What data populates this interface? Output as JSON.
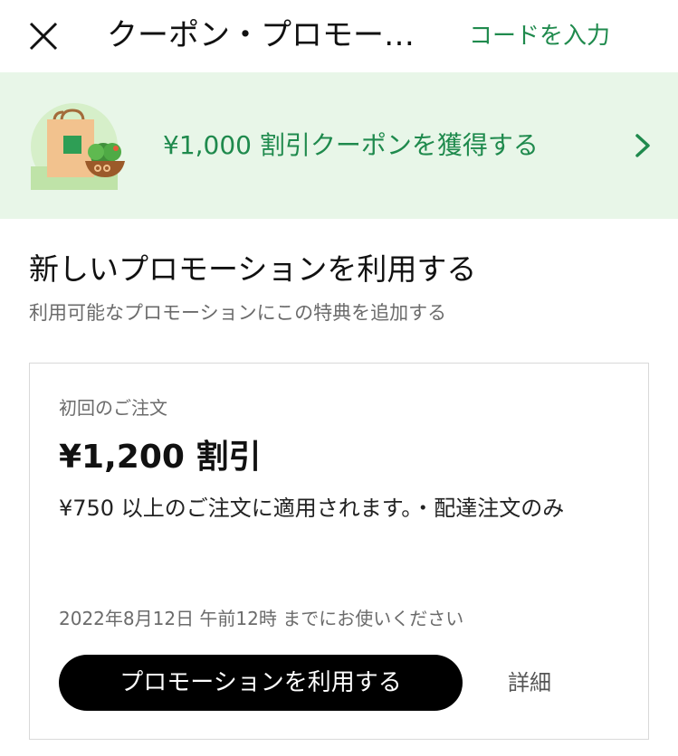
{
  "header": {
    "close_icon": "close-icon",
    "title": "クーポン・プロモー…",
    "enter_code_label": "コードを入力"
  },
  "banner": {
    "text": "¥1,000 割引クーポンを獲得する",
    "illustration": "grocery-bag-and-salad-illustration",
    "chevron_icon": "chevron-right-icon"
  },
  "section": {
    "title": "新しいプロモーションを利用する",
    "subtitle": "利用可能なプロモーションにこの特典を追加する"
  },
  "promo_card": {
    "eyebrow": "初回のご注文",
    "amount": "¥1,200 割引",
    "description": "¥750 以上のご注文に適用されます。・配達注文のみ",
    "expiry": "2022年8月12日 午前12時 までにお使いください",
    "apply_label": "プロモーションを利用する",
    "details_label": "詳細"
  },
  "colors": {
    "accent_green": "#1f8a4d",
    "banner_bg": "#e8f6e8",
    "button_bg": "#000000",
    "muted_text": "#6b6b6b"
  }
}
